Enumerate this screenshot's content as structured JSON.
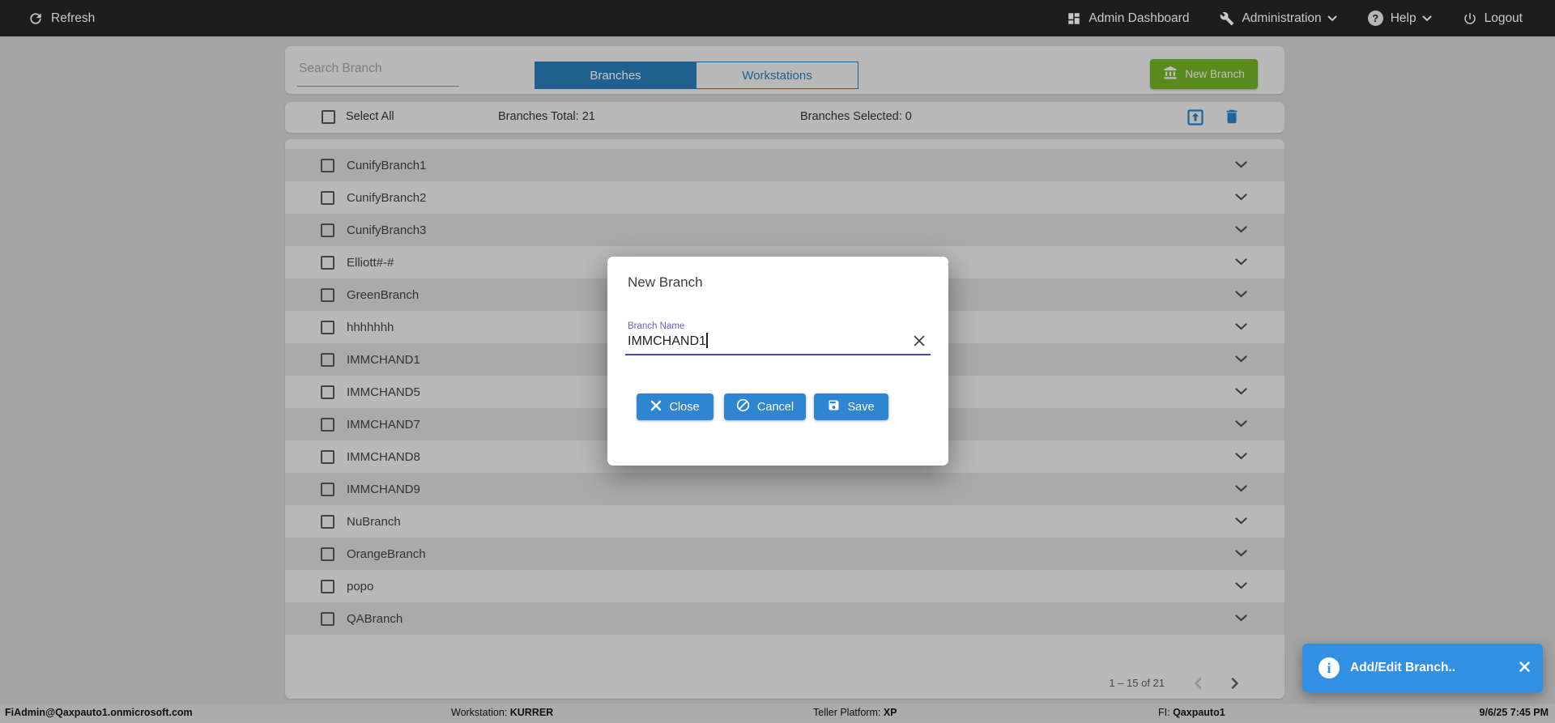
{
  "topbar": {
    "refresh_label": "Refresh",
    "admin_dashboard_label": "Admin Dashboard",
    "administration_label": "Administration",
    "help_label": "Help",
    "help_badge": "?",
    "logout_label": "Logout"
  },
  "toolbar": {
    "search_placeholder": "Search Branch",
    "tabs": [
      {
        "label": "Branches",
        "active": true
      },
      {
        "label": "Workstations",
        "active": false
      }
    ],
    "new_branch_label": "New Branch"
  },
  "list_header": {
    "select_all_label": "Select All",
    "branches_total_label": "Branches Total: 21",
    "branches_selected_label": "Branches Selected: 0"
  },
  "branches": [
    {
      "name": "CunifyBranch1"
    },
    {
      "name": "CunifyBranch2"
    },
    {
      "name": "CunifyBranch3"
    },
    {
      "name": "Elliott#-#"
    },
    {
      "name": "GreenBranch"
    },
    {
      "name": "hhhhhhh"
    },
    {
      "name": "IMMCHAND1"
    },
    {
      "name": "IMMCHAND5"
    },
    {
      "name": "IMMCHAND7"
    },
    {
      "name": "IMMCHAND8"
    },
    {
      "name": "IMMCHAND9"
    },
    {
      "name": "NuBranch"
    },
    {
      "name": "OrangeBranch"
    },
    {
      "name": "popo"
    },
    {
      "name": "QABranch"
    }
  ],
  "pagination": {
    "range_label": "1 – 15 of 21"
  },
  "modal": {
    "title": "New Branch",
    "field_label": "Branch Name",
    "field_value": "IMMCHAND1",
    "buttons": {
      "close": "Close",
      "cancel": "Cancel",
      "save": "Save"
    }
  },
  "toast": {
    "message": "Add/Edit Branch.."
  },
  "statusbar": {
    "user": "FiAdmin@Qaxpauto1.onmicrosoft.com",
    "workstation_label": "Workstation: ",
    "workstation_value": "KURRER",
    "teller_platform_label": "Teller Platform: ",
    "teller_platform_value": "XP",
    "fi_label": "FI: ",
    "fi_value": "Qaxpauto1",
    "datetime": "9/6/25 7:45 PM"
  },
  "icons": {
    "refresh-icon": "circular arrow",
    "dashboard-icon": "grid of tiles",
    "wrench-icon": "wrench",
    "question-icon": "? in circle",
    "power-icon": "power symbol",
    "bank-icon": "classical bank building",
    "export-icon": "up arrow in square outline",
    "trash-icon": "trash can",
    "chevron-down-icon": "v caret",
    "close-x-icon": "x cross",
    "block-icon": "circle with slash",
    "save-floppy-icon": "floppy disk",
    "info-icon": "i in circle"
  },
  "colors": {
    "topbar_bg": "#262626",
    "accent_blue": "#2a7cb8",
    "icon_blue": "#2480c4",
    "new_branch_green": "#74b027",
    "modal_button_blue": "#2e86d3",
    "toast_blue": "#3190e2",
    "field_underline_indigo": "#3a4bb3",
    "field_label_purple": "#6a5ac9"
  }
}
